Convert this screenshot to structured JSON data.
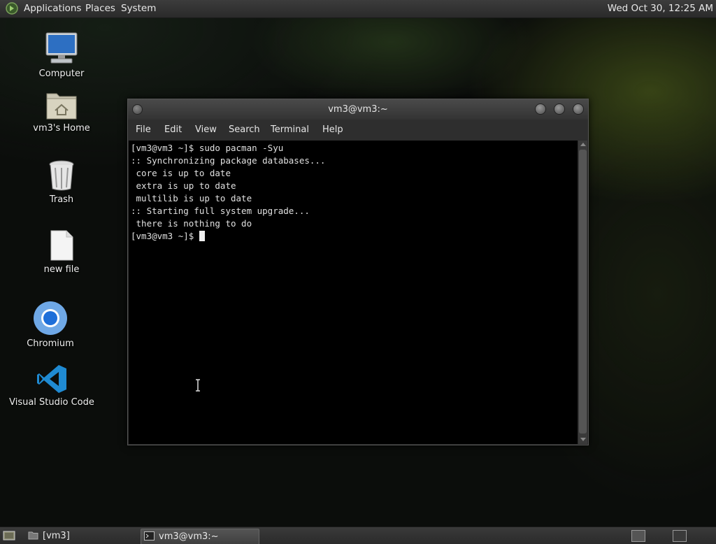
{
  "top_panel": {
    "menus": [
      "Applications",
      "Places",
      "System"
    ],
    "clock": "Wed Oct 30, 12:25 AM"
  },
  "desktop_icons": [
    {
      "label": "Computer",
      "icon": "computer-icon"
    },
    {
      "label": "vm3's Home",
      "icon": "home-folder-icon"
    },
    {
      "label": "Trash",
      "icon": "trash-icon"
    },
    {
      "label": "new file",
      "icon": "file-icon"
    },
    {
      "label": "Chromium",
      "icon": "chromium-icon"
    },
    {
      "label": "Visual Studio Code",
      "icon": "vscode-icon"
    }
  ],
  "terminal": {
    "title": "vm3@vm3:~",
    "menu": [
      "File",
      "Edit",
      "View",
      "Search",
      "Terminal",
      "Help"
    ],
    "lines": [
      "[vm3@vm3 ~]$ sudo pacman -Syu",
      ":: Synchronizing package databases...",
      " core is up to date",
      " extra is up to date",
      " multilib is up to date",
      ":: Starting full system upgrade...",
      " there is nothing to do"
    ],
    "prompt": "[vm3@vm3 ~]$ "
  },
  "taskbar": {
    "tasks": [
      {
        "label": "[vm3]",
        "icon": "folder-icon",
        "active": false
      },
      {
        "label": "vm3@vm3:~",
        "icon": "terminal-icon",
        "active": true
      }
    ]
  },
  "colors": {
    "terminal_bg": "#000000",
    "panel_bg": "#333333"
  }
}
